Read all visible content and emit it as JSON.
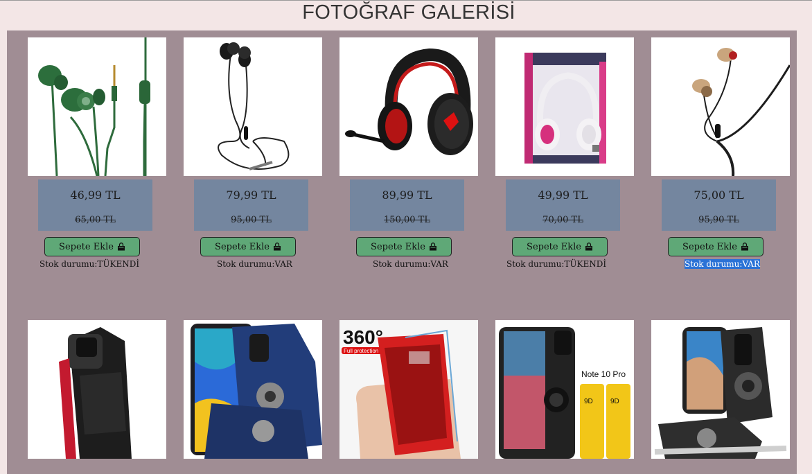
{
  "header": {
    "title": "FOTOĞRAF GALERİSİ"
  },
  "colors": {
    "page_background": "#f3e6e6",
    "gallery_background": "#a08d94",
    "price_box": "#74869f",
    "cart_button": "#5fa877",
    "selection": "#2a72d6"
  },
  "products": [
    {
      "image": "green-earphones",
      "price": "46,99 TL",
      "old_price": "65,00 TL",
      "button_label": "Sepete Ekle",
      "button_icon": "shopping-bag-icon",
      "stock": "Stok durumu:TÜKENDİ"
    },
    {
      "image": "black-earphones",
      "price": "79,99 TL",
      "old_price": "95,00 TL",
      "button_label": "Sepete Ekle",
      "button_icon": "shopping-bag-icon",
      "stock": "Stok durumu:VAR"
    },
    {
      "image": "gaming-headset",
      "price": "89,99 TL",
      "old_price": "150,00 TL",
      "button_label": "Sepete Ekle",
      "button_icon": "shopping-bag-icon",
      "stock": "Stok durumu:VAR"
    },
    {
      "image": "boxed-headphones",
      "price": "49,99 TL",
      "old_price": "70,00 TL",
      "button_label": "Sepete Ekle",
      "button_icon": "shopping-bag-icon",
      "stock": "Stok durumu:TÜKENDİ"
    },
    {
      "image": "wooden-earphones",
      "price": "75,00 TL",
      "old_price": "95,90 TL",
      "button_label": "Sepete Ekle",
      "button_icon": "shopping-bag-icon",
      "stock": "Stok durumu:VAR"
    }
  ],
  "cases": [
    {
      "image": "black-ring-case"
    },
    {
      "image": "navy-armor-case"
    },
    {
      "image": "red-360-case",
      "badge": "360°",
      "badge_sub": "Full protection"
    },
    {
      "image": "black-case-with-screen-glass",
      "label": "Note 10 Pro",
      "glass_label_a": "9D",
      "glass_label_b": "9D"
    },
    {
      "image": "armor-ring-case"
    }
  ]
}
